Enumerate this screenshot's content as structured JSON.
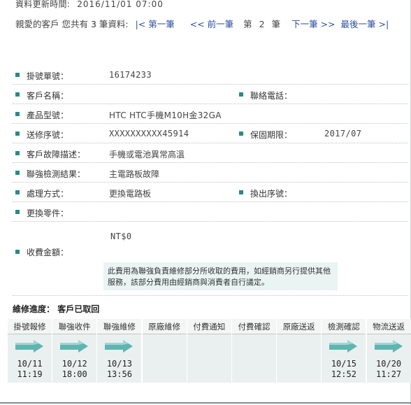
{
  "update": {
    "label": "資料更新時間:",
    "datetime": "2016/11/01 07:00"
  },
  "nav": {
    "greeting": "親愛的客戶 您共有",
    "count": "3",
    "unit": "筆資料:",
    "first": "|< 第一筆",
    "prev": "<< 前一筆",
    "current_prefix": "第",
    "current": "2",
    "current_suffix": "筆",
    "next": "下一筆 >>",
    "last": "最後一筆 >|"
  },
  "fields": {
    "order_no_label": "掛號單號：",
    "order_no": "16174233",
    "customer_label": "客戶名稱：",
    "customer": "",
    "phone_label": "聯絡電話：",
    "phone": "",
    "model_label": "產品型號：",
    "model": "HTC HTC手機M10H金32GA",
    "serial_label": "送修序號：",
    "serial": "XXXXXXXXXX45914",
    "warranty_label": "保固期限：",
    "warranty": "2017/07",
    "fault_label": "客戶故障描述：",
    "fault": "手機或電池異常高溫",
    "check_label": "聯強檢測結果：",
    "check": "主電路板故障",
    "method_label": "處理方式：",
    "method": "更換電路板",
    "swap_label": "換出序號：",
    "swap": "",
    "parts_label": "更換零件：",
    "parts": "",
    "fee_label": "收費金額：",
    "fee": "NT$0",
    "fee_note": "此費用為聯強負責維修部分所收取的費用，如經銷商另行提供其他服務，該部分費用由經銷商與消費者自行議定。"
  },
  "status": {
    "label": "維修進度：",
    "value": "客戶已取回"
  },
  "progress": [
    {
      "label": "掛號報修",
      "done": true,
      "date": "10/11",
      "time": "11:19"
    },
    {
      "label": "聯強收件",
      "done": true,
      "date": "10/12",
      "time": "18:00"
    },
    {
      "label": "聯強維修",
      "done": true,
      "date": "10/13",
      "time": "13:56"
    },
    {
      "label": "原廠維修",
      "done": false,
      "date": "",
      "time": ""
    },
    {
      "label": "付費通知",
      "done": false,
      "date": "",
      "time": ""
    },
    {
      "label": "付費確認",
      "done": false,
      "date": "",
      "time": ""
    },
    {
      "label": "原廠送返",
      "done": false,
      "date": "",
      "time": ""
    },
    {
      "label": "檢測確認",
      "done": true,
      "date": "10/15",
      "time": "12:52"
    },
    {
      "label": "物流送返",
      "done": true,
      "date": "10/20",
      "time": "11:27"
    }
  ],
  "colors": {
    "accent": "#2a8a87",
    "link": "#2c4fa0",
    "arrow": "#5fb5b0",
    "panel": "#eaf0ef"
  }
}
